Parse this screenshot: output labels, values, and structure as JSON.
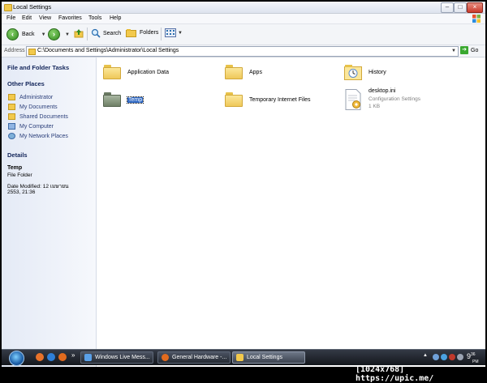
{
  "window": {
    "title": "Local Settings"
  },
  "menu": [
    "File",
    "Edit",
    "View",
    "Favorites",
    "Tools",
    "Help"
  ],
  "toolbar": {
    "back": "Back",
    "search": "Search",
    "folders": "Folders"
  },
  "address": {
    "label": "Address",
    "path": "C:\\Documents and Settings\\Administrator\\Local Settings",
    "go": "Go"
  },
  "taskpane": {
    "file_folder_tasks": "File and Folder Tasks",
    "other_places": "Other Places",
    "places": [
      "Administrator",
      "My Documents",
      "Shared Documents",
      "My Computer",
      "My Network Places"
    ],
    "details": {
      "heading": "Details",
      "name": "Temp",
      "type": "File Folder",
      "modified_line1": "Date Modified: 12 เมษายน",
      "modified_line2": "2553, 21:36"
    }
  },
  "files": [
    {
      "name": "Application Data",
      "icon": "folder-icon"
    },
    {
      "name": "Apps",
      "icon": "folder-icon"
    },
    {
      "name": "History",
      "icon": "history-folder-icon"
    },
    {
      "name": "Temp",
      "icon": "folder-icon",
      "selected": true
    },
    {
      "name": "Temporary Internet Files",
      "icon": "folder-icon"
    },
    {
      "name": "desktop.ini",
      "icon": "config-file-icon",
      "desc": "Configuration Settings",
      "size": "1 KB"
    }
  ],
  "taskbar": {
    "buttons": [
      "Windows Live Mess...",
      "General Hardware -...",
      "Local Settings"
    ],
    "active": "Local Settings",
    "clock_hour": "9",
    "clock_min": "36",
    "clock_sub": "PM"
  },
  "watermark": "[1024x768] https://upic.me/",
  "colors": {
    "selection": "#316ac5",
    "taskpane_heading": "#12255a",
    "taskpane_link": "#2b3f7a"
  }
}
